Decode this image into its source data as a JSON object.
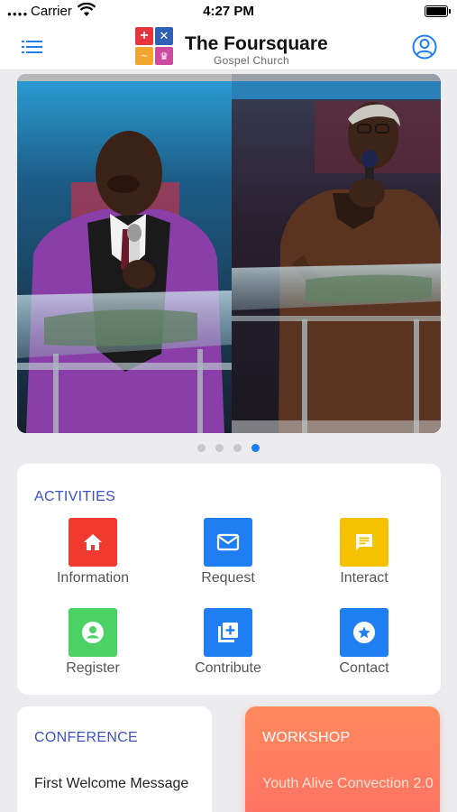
{
  "status_bar": {
    "carrier": "Carrier",
    "time": "4:27 PM"
  },
  "header": {
    "title": "The Foursquare",
    "subtitle": "Gospel Church"
  },
  "icons": {
    "menu": "list-menu-icon",
    "profile": "user-circle-icon",
    "battery": "battery-icon",
    "wifi": "wifi-icon",
    "logo": "church-logo"
  },
  "colors": {
    "accent": "#3d52c4",
    "active_dot": "#1a7ff0",
    "workshop_gradient": [
      "#ff8a5c",
      "#ff6f66"
    ]
  },
  "carousel": {
    "slide_count": 4,
    "active_index": 3
  },
  "activities": {
    "title": "ACTIVITIES",
    "items": [
      {
        "label": "Information",
        "icon": "home-icon",
        "color": "#f03a2f"
      },
      {
        "label": "Request",
        "icon": "mail-icon",
        "color": "#1e7ef2"
      },
      {
        "label": "Interact",
        "icon": "chat-icon",
        "color": "#f6c100"
      },
      {
        "label": "Register",
        "icon": "account-circle-icon",
        "color": "#4cd264"
      },
      {
        "label": "Contribute",
        "icon": "add-box-icon",
        "color": "#1e7ef2"
      },
      {
        "label": "Contact",
        "icon": "star-circle-icon",
        "color": "#1e7ef2"
      }
    ]
  },
  "cards": {
    "conference": {
      "title": "CONFERENCE",
      "text": "First Welcome Message"
    },
    "workshop": {
      "title": "WORKSHOP",
      "text": "Youth Alive Convection 2.0"
    }
  }
}
